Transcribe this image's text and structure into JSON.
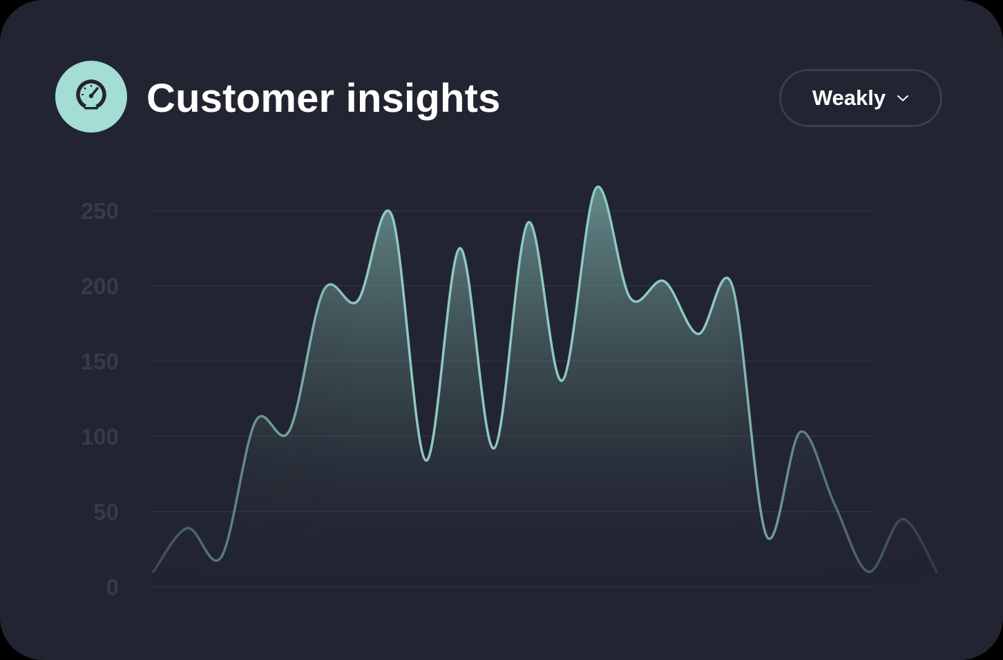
{
  "header": {
    "title": "Customer insights",
    "icon": "speedometer-icon"
  },
  "period_select": {
    "selected": "Weakly",
    "icon": "chevron-down-icon"
  },
  "colors": {
    "card_background": "#222531",
    "accent": "#a3ddd5",
    "line": "#8ec9c1",
    "grid": "#2c303b",
    "tick_label": "#363b45",
    "button_border": "#3c3f48"
  },
  "chart_data": {
    "type": "area",
    "title": "",
    "xlabel": "",
    "ylabel": "",
    "ylim": [
      0,
      250
    ],
    "yticks": [
      0,
      50,
      100,
      150,
      200,
      250
    ],
    "yticks_labels": [
      "0",
      "50",
      "100",
      "150",
      "200",
      "250"
    ],
    "grid": true,
    "series": [
      {
        "values": [
          10,
          39,
          20,
          110,
          104,
          197,
          190,
          247,
          84,
          225,
          92,
          242,
          137,
          265,
          192,
          203,
          168,
          200,
          34,
          103,
          55,
          10,
          45,
          10
        ]
      }
    ]
  }
}
